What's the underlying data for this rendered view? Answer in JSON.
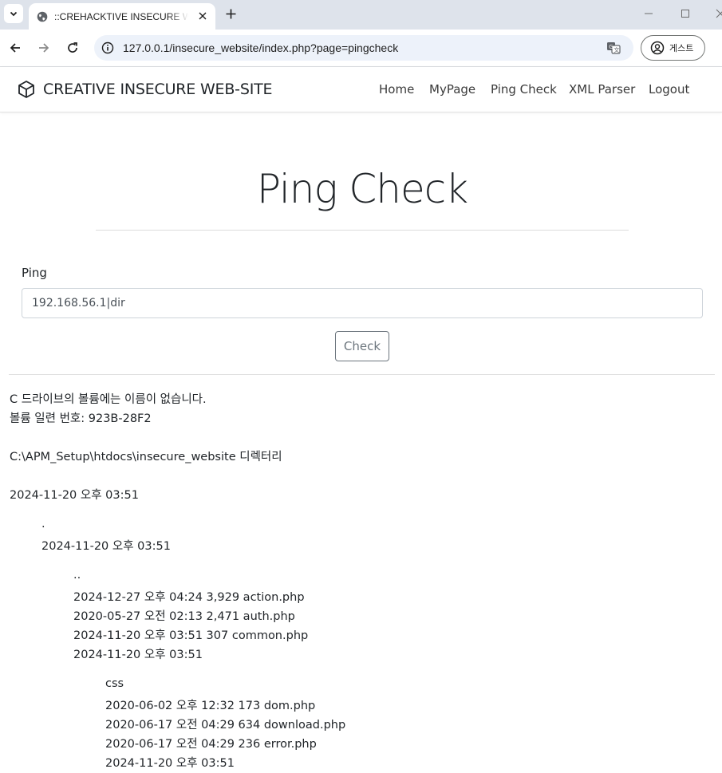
{
  "browser": {
    "tab_title": "::CREHACKTIVE INSECURE WEBSITE::",
    "url": "127.0.0.1/insecure_website/index.php?page=pingcheck",
    "profile_label": "게스트"
  },
  "site": {
    "brand": "CREATIVE INSECURE WEB-SITE",
    "nav": [
      "Home",
      "MyPage",
      "Ping Check",
      "XML Parser",
      "Logout"
    ]
  },
  "page": {
    "title": "Ping Check",
    "ping_label": "Ping",
    "ping_value": "192.168.56.1|dir",
    "check_label": "Check"
  },
  "output": {
    "lines": [
      "C 드라이브의 볼륨에는 이름이 없습니다.",
      "볼륨 일련 번호: 923B-28F2",
      "C:\\APM_Setup\\htdocs\\insecure_website 디렉터리",
      "2024-11-20 오후 03:51",
      ".",
      "2024-11-20 오후 03:51",
      "..",
      "2024-12-27 오후 04:24 3,929 action.php",
      "2020-05-27 오전 02:13 2,471 auth.php",
      "2024-11-20 오후 03:51 307 common.php",
      "2024-11-20 오후 03:51",
      "css",
      "2020-06-02 오후 12:32 173 dom.php",
      "2020-06-17 오전 04:29 634 download.php",
      "2020-06-17 오전 04:29 236 error.php",
      "2024-11-20 오후 03:51"
    ]
  }
}
